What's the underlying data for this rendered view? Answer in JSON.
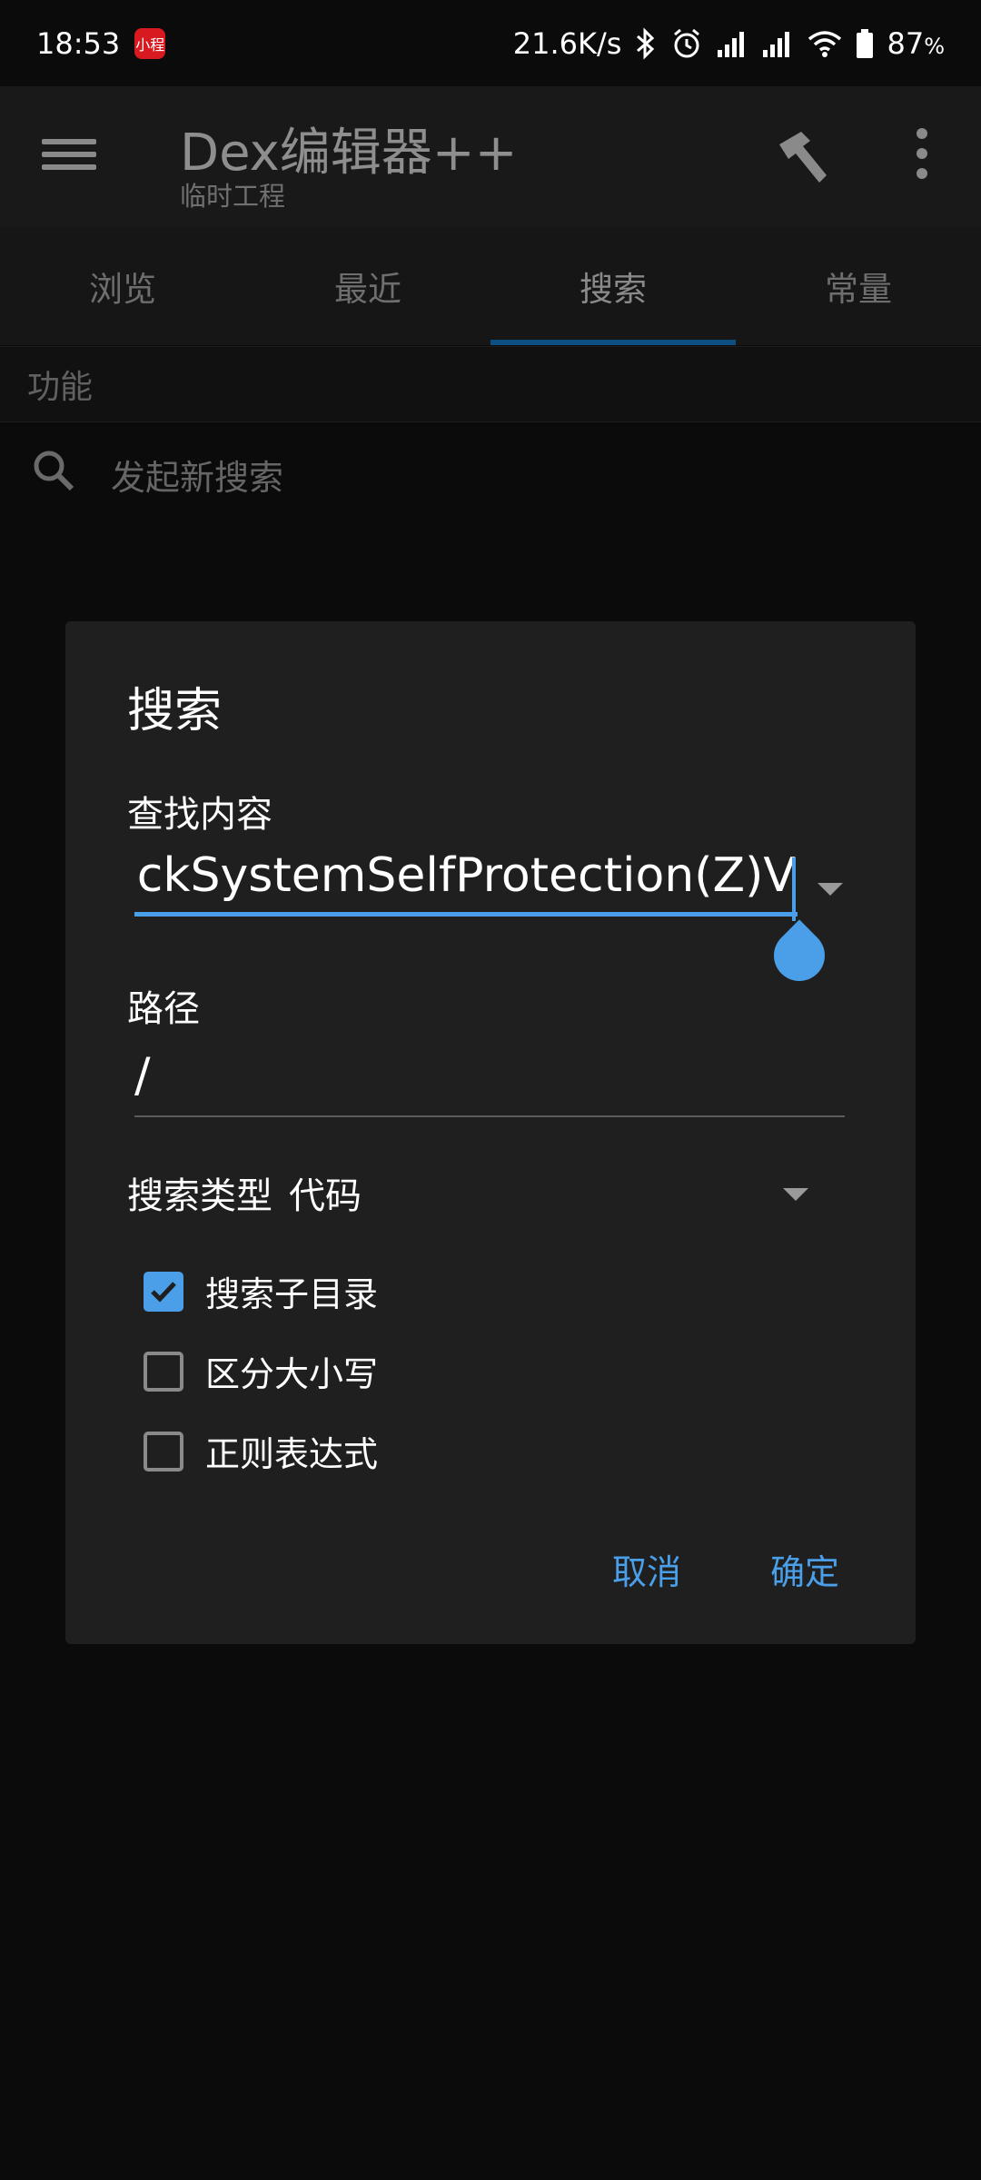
{
  "status_bar": {
    "time": "18:53",
    "app_badge": "小程",
    "net_speed": "21.6K/s",
    "battery": "87",
    "battery_unit": "%"
  },
  "app_bar": {
    "title": "Dex编辑器++",
    "subtitle": "临时工程"
  },
  "tabs": [
    {
      "label": "浏览"
    },
    {
      "label": "最近"
    },
    {
      "label": "搜索"
    },
    {
      "label": "常量"
    }
  ],
  "section_header": "功能",
  "search_row": {
    "label": "发起新搜索"
  },
  "dialog": {
    "title": "搜索",
    "find_label": "查找内容",
    "find_value": "checkSystemSelfProtection(Z)V",
    "path_label": "路径",
    "path_value": "/",
    "search_type_label": "搜索类型",
    "search_type_value": "代码",
    "options": [
      {
        "label": "搜索子目录",
        "checked": true
      },
      {
        "label": "区分大小写",
        "checked": false
      },
      {
        "label": "正则表达式",
        "checked": false
      }
    ],
    "cancel_label": "取消",
    "ok_label": "确定"
  },
  "colors": {
    "accent": "#4a9fe8",
    "tab_indicator": "#0d4f80",
    "dialog_bg": "#1f1f1f"
  }
}
